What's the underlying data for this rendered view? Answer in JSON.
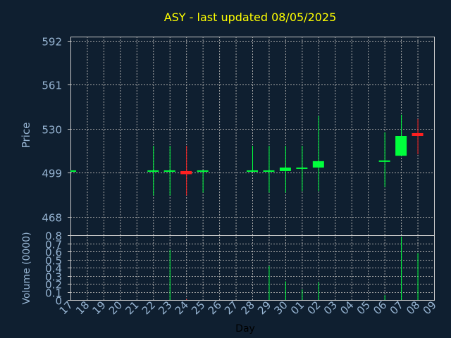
{
  "chart_data": [
    {
      "type": "candlestick",
      "title": "ASY - last updated 08/05/2025",
      "ylabel": "Price",
      "xlabel": "",
      "ylim": [
        455,
        595
      ],
      "y_ticks": [
        "592",
        "561",
        "530",
        "499",
        "468"
      ],
      "y_tick_values": [
        592,
        561,
        530,
        499,
        468
      ],
      "grid": true,
      "colors": {
        "up": "#00ff3c",
        "down": "#ff2020",
        "title": "#ffff00",
        "grid": "#a8a8a8",
        "tick": "#96b4d2"
      },
      "candles": [
        {
          "day": "17",
          "open": 500.2,
          "high": 500.2,
          "low": 500.2,
          "close": 500.2
        },
        {
          "day": "22",
          "open": 500.2,
          "high": 518.0,
          "low": 483.0,
          "close": 500.2
        },
        {
          "day": "23",
          "open": 500.2,
          "high": 518.0,
          "low": 483.0,
          "close": 500.2
        },
        {
          "day": "24",
          "open": 500.2,
          "high": 518.0,
          "low": 483.0,
          "close": 498.0
        },
        {
          "day": "25",
          "open": 500.2,
          "high": 500.2,
          "low": 485.0,
          "close": 500.2
        },
        {
          "day": "28",
          "open": 500.2,
          "high": 518.0,
          "low": 500.2,
          "close": 500.2
        },
        {
          "day": "29",
          "open": 500.2,
          "high": 518.0,
          "low": 485.0,
          "close": 500.2
        },
        {
          "day": "30",
          "open": 500.2,
          "high": 518.0,
          "low": 485.0,
          "close": 502.7
        },
        {
          "day": "01",
          "open": 502.2,
          "high": 518.0,
          "low": 486.0,
          "close": 502.2
        },
        {
          "day": "02",
          "open": 502.7,
          "high": 539.0,
          "low": 486.0,
          "close": 507.2
        },
        {
          "day": "06",
          "open": 507.2,
          "high": 527.5,
          "low": 489.0,
          "close": 507.2
        },
        {
          "day": "07",
          "open": 511.0,
          "high": 540.0,
          "low": 511.0,
          "close": 525.0
        },
        {
          "day": "08",
          "open": 527.0,
          "high": 537.0,
          "low": 512.0,
          "close": 525.0
        }
      ]
    },
    {
      "type": "bar",
      "ylabel": "Volume (0000)",
      "xlabel": "Day",
      "ylim": [
        0,
        0.8
      ],
      "y_ticks": [
        "0.8",
        "0.7",
        "0.6",
        "0.5",
        "0.4",
        "0.3",
        "0.2",
        "0.1",
        "0"
      ],
      "y_tick_values": [
        0.8,
        0.7,
        0.6,
        0.5,
        0.4,
        0.3,
        0.2,
        0.1,
        0
      ],
      "categories": [
        "17",
        "18",
        "19",
        "20",
        "21",
        "22",
        "23",
        "24",
        "25",
        "26",
        "27",
        "28",
        "29",
        "30",
        "01",
        "02",
        "03",
        "04",
        "05",
        "06",
        "07",
        "08",
        "09"
      ],
      "series": [
        {
          "values": [
            0,
            0,
            0,
            0,
            0,
            0,
            0.62,
            0.01,
            0,
            0,
            0,
            0,
            0.42,
            0.23,
            0.13,
            0.22,
            0,
            0,
            0,
            0.06,
            0.78,
            0.58,
            0
          ]
        }
      ]
    }
  ]
}
